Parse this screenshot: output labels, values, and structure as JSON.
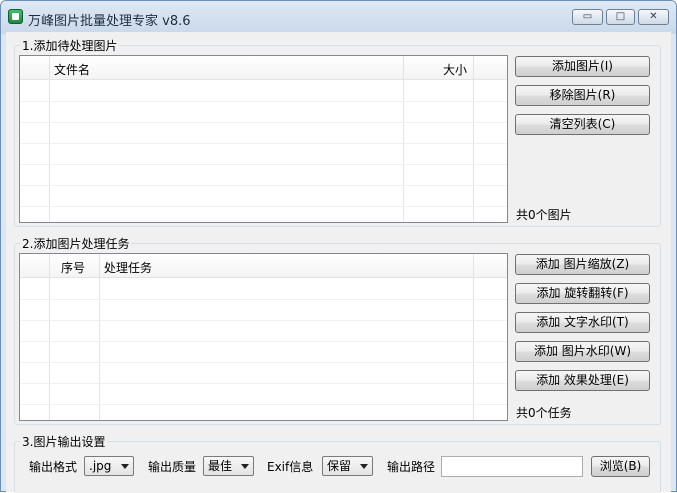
{
  "window": {
    "title": "万峰图片批量处理专家 v8.6",
    "controls": {
      "minimize": "▭",
      "maximize": "□",
      "close": "✕"
    }
  },
  "section1": {
    "label": "1.添加待处理图片",
    "columns": {
      "filename": "文件名",
      "size": "大小"
    },
    "rows": [],
    "buttons": {
      "add": "添加图片(I)",
      "remove": "移除图片(R)",
      "clear": "清空列表(C)"
    },
    "count": "共0个图片"
  },
  "section2": {
    "label": "2.添加图片处理任务",
    "columns": {
      "index": "序号",
      "task": "处理任务"
    },
    "rows": [],
    "buttons": {
      "resize": "添加 图片缩放(Z)",
      "rotate": "添加 旋转翻转(F)",
      "text_watermark": "添加 文字水印(T)",
      "image_watermark": "添加 图片水印(W)",
      "effect": "添加 效果处理(E)"
    },
    "count": "共0个任务"
  },
  "section3": {
    "label": "3.图片输出设置",
    "format_label": "输出格式",
    "format_value": ".jpg",
    "quality_label": "输出质量",
    "quality_value": "最佳",
    "exif_label": "Exif信息",
    "exif_value": "保留",
    "path_label": "输出路径",
    "path_value": "",
    "browse_button": "浏览(B)"
  }
}
